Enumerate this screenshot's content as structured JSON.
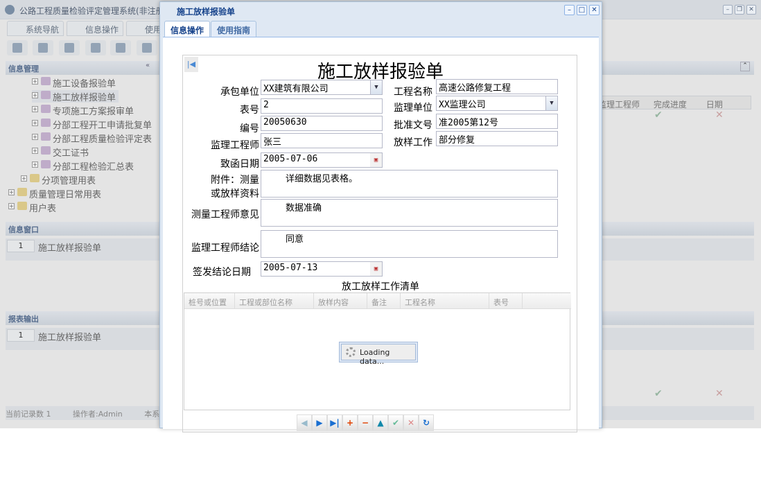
{
  "app": {
    "title": "公路工程质量检验评定管理系统(非注册用户)",
    "nav_tabs": [
      {
        "label": "系统导航"
      },
      {
        "label": "信息操作"
      },
      {
        "label": "使用"
      }
    ]
  },
  "sidebar": {
    "section_title": "信息管理",
    "tree": [
      {
        "label": "施工设备报验单",
        "level": 2
      },
      {
        "label": "施工放样报验单",
        "level": 2,
        "selected": true
      },
      {
        "label": "专项施工方案报审单",
        "level": 2
      },
      {
        "label": "分部工程开工申请批复单",
        "level": 2
      },
      {
        "label": "分部工程质量检验评定表",
        "level": 2
      },
      {
        "label": "交工证书",
        "level": 2
      },
      {
        "label": "分部工程检验汇总表",
        "level": 2
      },
      {
        "label": "分项管理用表",
        "level": 1
      },
      {
        "label": "质量管理日常用表",
        "level": 0
      },
      {
        "label": "用户表",
        "level": 0
      }
    ]
  },
  "info_window": {
    "title": "信息窗口",
    "items": [
      {
        "num": "1",
        "label": "施工放样报验单"
      }
    ]
  },
  "report_output": {
    "title": "报表输出",
    "items": [
      {
        "num": "1",
        "label": "施工放样报验单"
      }
    ]
  },
  "status_bar": {
    "record_count": "当前记录数 1",
    "operator": "操作者:Admin",
    "extra": "本系"
  },
  "bg_grid": {
    "headers": [
      "监理工程师",
      "完成进度",
      "日期"
    ]
  },
  "modal": {
    "title": "施工放样报验单",
    "tabs": [
      {
        "label": "信息操作",
        "active": true
      },
      {
        "label": "使用指南"
      }
    ],
    "form": {
      "title": "施工放样报验单",
      "contractor_label": "承包单位",
      "contractor": "XX建筑有限公司",
      "project_name_label": "工程名称",
      "project_name": "高速公路修复工程",
      "form_no_label": "表号",
      "form_no": "2",
      "supervisor_unit_label": "监理单位",
      "supervisor_unit": "XX监理公司",
      "serial_label": "编号",
      "serial": "20050630",
      "approval_no_label": "批准文号",
      "approval_no": "准2005第12号",
      "engineer_label": "监理工程师",
      "engineer": "张三",
      "staking_work_label": "放样工作",
      "staking_work": "部分修复",
      "letter_date_label": "致函日期",
      "letter_date": "2005-07-06",
      "attachment_label_1": "附件：测量",
      "attachment_label_2": "或放样资料",
      "attachment": "详细数据见表格。",
      "survey_opinion_label": "测量工程师意见",
      "survey_opinion": "数据准确",
      "conclusion_label": "监理工程师结论",
      "conclusion": "同意",
      "sign_date_label": "签发结论日期",
      "sign_date": "2005-07-13"
    },
    "grid": {
      "title": "放工放样工作清单",
      "headers": [
        "桩号或位置",
        "工程或部位名称",
        "放样内容",
        "备注",
        "工程名称",
        "表号"
      ],
      "loading": "Loading data..."
    },
    "pager": [
      "prev",
      "next",
      "last",
      "add",
      "remove",
      "up",
      "confirm",
      "cancel",
      "refresh"
    ]
  }
}
